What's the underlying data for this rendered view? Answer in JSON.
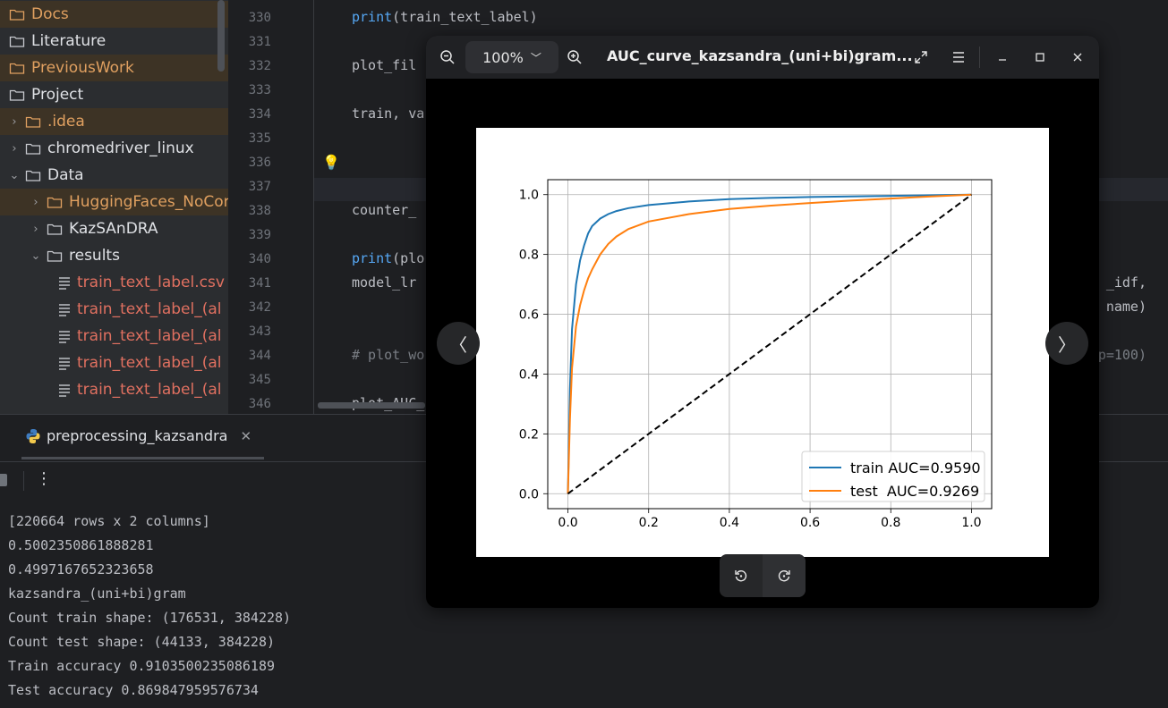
{
  "tree": {
    "items": [
      {
        "label": "Docs",
        "type": "folder",
        "indent": 0,
        "arrow": "",
        "style": "orange hl"
      },
      {
        "label": "Literature",
        "type": "folder",
        "indent": 0,
        "arrow": "",
        "style": ""
      },
      {
        "label": "PreviousWork",
        "type": "folder",
        "indent": 0,
        "arrow": "",
        "style": "orange hl"
      },
      {
        "label": "Project",
        "type": "folder",
        "indent": 0,
        "arrow": "",
        "style": ""
      },
      {
        "label": ".idea",
        "type": "folder",
        "indent": 1,
        "arrow": "›",
        "style": "orange hl"
      },
      {
        "label": "chromedriver_linux",
        "type": "folder",
        "indent": 1,
        "arrow": "›",
        "style": ""
      },
      {
        "label": "Data",
        "type": "folder",
        "indent": 1,
        "arrow": "⌄",
        "style": ""
      },
      {
        "label": "HuggingFaces_NoCor",
        "type": "folder",
        "indent": 2,
        "arrow": "›",
        "style": "orange hl"
      },
      {
        "label": "KazSAnDRA",
        "type": "folder",
        "indent": 2,
        "arrow": "›",
        "style": ""
      },
      {
        "label": "results",
        "type": "folder",
        "indent": 2,
        "arrow": "⌄",
        "style": ""
      },
      {
        "label": "train_text_label.csv",
        "type": "file",
        "indent": 3,
        "arrow": "",
        "style": "red"
      },
      {
        "label": "train_text_label_(al",
        "type": "file",
        "indent": 3,
        "arrow": "",
        "style": "red"
      },
      {
        "label": "train_text_label_(al",
        "type": "file",
        "indent": 3,
        "arrow": "",
        "style": "red"
      },
      {
        "label": "train_text_label_(al",
        "type": "file",
        "indent": 3,
        "arrow": "",
        "style": "red"
      },
      {
        "label": "train_text_label_(al",
        "type": "file",
        "indent": 3,
        "arrow": "",
        "style": "red"
      }
    ]
  },
  "editor": {
    "lines": [
      {
        "n": "330",
        "code": [
          {
            "t": "print",
            "c": "kw"
          },
          {
            "t": "(train_text_label)",
            "c": ""
          }
        ]
      },
      {
        "n": "331",
        "code": []
      },
      {
        "n": "332",
        "code": [
          {
            "t": "plot_fil",
            "c": ""
          }
        ]
      },
      {
        "n": "333",
        "code": []
      },
      {
        "n": "334",
        "code": [
          {
            "t": "train, va",
            "c": ""
          }
        ]
      },
      {
        "n": "335",
        "code": []
      },
      {
        "n": "336",
        "code": []
      },
      {
        "n": "337",
        "code": []
      },
      {
        "n": "338",
        "code": [
          {
            "t": "counter_",
            "c": ""
          }
        ]
      },
      {
        "n": "339",
        "code": []
      },
      {
        "n": "340",
        "code": [
          {
            "t": "print",
            "c": "kw"
          },
          {
            "t": "(plo",
            "c": ""
          }
        ]
      },
      {
        "n": "341",
        "code": [
          {
            "t": "model_lr",
            "c": ""
          }
        ]
      },
      {
        "n": "342",
        "code": []
      },
      {
        "n": "343",
        "code": []
      },
      {
        "n": "344",
        "code": [
          {
            "t": "# plot_wo",
            "c": "cm"
          }
        ]
      },
      {
        "n": "345",
        "code": []
      },
      {
        "n": "346",
        "code": [
          {
            "t": "plot_AUC_",
            "c": ""
          }
        ]
      }
    ],
    "right_fragments": [
      {
        "text": "_idf,",
        "row": 11,
        "c": ""
      },
      {
        "text": "name)",
        "row": 12,
        "c": ""
      },
      {
        "text": "p=100)",
        "row": 14,
        "c": "cm"
      }
    ]
  },
  "run": {
    "tab_label": "preprocessing_kazsandra",
    "console": [
      "[220664 rows x 2 columns]",
      "0.5002350861888281",
      "0.4997167652323658",
      "kazsandra_(uni+bi)gram",
      "Count train shape: (176531, 384228)",
      "Count test shape: (44133, 384228)",
      "Train accuracy 0.9103500235086189",
      "Test accuracy 0.869847959576734"
    ]
  },
  "viewer": {
    "zoom": "100%",
    "title": "AUC_curve_kazsandra_(uni+bi)gram...",
    "icons": {
      "zoom_out": "zoom-out-icon",
      "zoom_in": "zoom-in-icon",
      "fullscreen": "fullscreen-icon",
      "menu": "menu-icon",
      "minimize": "minimize-icon",
      "maximize": "maximize-icon",
      "close": "close-icon",
      "prev": "chevron-left-icon",
      "next": "chevron-right-icon",
      "rotate_left": "rotate-left-icon",
      "rotate_right": "rotate-right-icon"
    }
  },
  "chart_data": {
    "type": "line",
    "title": "",
    "xlabel": "",
    "ylabel": "",
    "xlim": [
      0,
      1
    ],
    "ylim": [
      0,
      1
    ],
    "xticks": [
      "0.0",
      "0.2",
      "0.4",
      "0.6",
      "0.8",
      "1.0"
    ],
    "yticks": [
      "0.0",
      "0.2",
      "0.4",
      "0.6",
      "0.8",
      "1.0"
    ],
    "grid": true,
    "legend_position": "lower-right",
    "series": [
      {
        "name": "train AUC=0.9590",
        "color": "#1f77b4",
        "x": [
          0,
          0.005,
          0.01,
          0.02,
          0.03,
          0.04,
          0.05,
          0.06,
          0.08,
          0.1,
          0.12,
          0.15,
          0.2,
          0.3,
          0.4,
          0.5,
          0.6,
          0.7,
          0.8,
          0.9,
          1.0
        ],
        "y": [
          0,
          0.35,
          0.55,
          0.7,
          0.78,
          0.83,
          0.87,
          0.895,
          0.92,
          0.935,
          0.945,
          0.955,
          0.965,
          0.977,
          0.985,
          0.989,
          0.992,
          0.994,
          0.996,
          0.998,
          1.0
        ]
      },
      {
        "name": "test  AUC=0.9269",
        "color": "#ff7f0e",
        "x": [
          0,
          0.005,
          0.01,
          0.02,
          0.03,
          0.04,
          0.05,
          0.06,
          0.08,
          0.1,
          0.12,
          0.15,
          0.2,
          0.3,
          0.4,
          0.5,
          0.6,
          0.7,
          0.8,
          0.9,
          1.0
        ],
        "y": [
          0,
          0.25,
          0.42,
          0.56,
          0.63,
          0.68,
          0.72,
          0.75,
          0.8,
          0.835,
          0.86,
          0.885,
          0.91,
          0.935,
          0.952,
          0.963,
          0.972,
          0.98,
          0.987,
          0.994,
          1.0
        ]
      },
      {
        "name": "",
        "color": "#000000",
        "dashed": true,
        "x": [
          0,
          1
        ],
        "y": [
          0,
          1
        ]
      }
    ]
  }
}
